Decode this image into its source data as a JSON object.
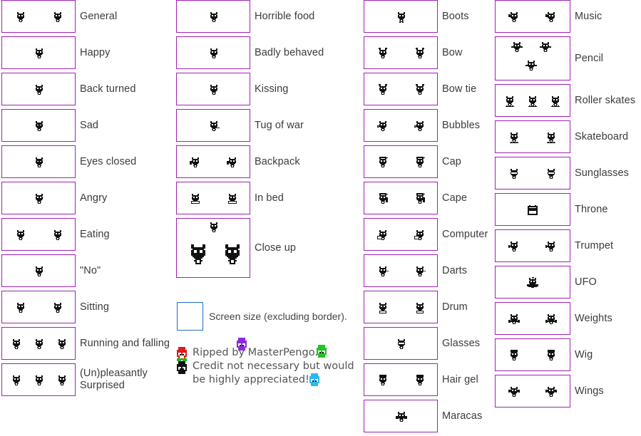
{
  "page": {
    "title": "Bub / pixel-art sprite sheet reference",
    "border_color": "#A021B5",
    "legend_border_color": "#1F6FC4",
    "text_color": "#3b3b3b",
    "background": "#ffffff"
  },
  "columns": [
    {
      "id": "column-1",
      "rows": [
        {
          "label": "General",
          "sprite_count": 2,
          "sprite": "creature-standing"
        },
        {
          "label": "Happy",
          "sprite_count": 1,
          "sprite": "creature-happy"
        },
        {
          "label": "Back turned",
          "sprite_count": 1,
          "sprite": "creature-back"
        },
        {
          "label": "Sad",
          "sprite_count": 1,
          "sprite": "creature-sad"
        },
        {
          "label": "Eyes closed",
          "sprite_count": 1,
          "sprite": "creature-eyes-closed"
        },
        {
          "label": "Angry",
          "sprite_count": 1,
          "sprite": "creature-angry"
        },
        {
          "label": "Eating",
          "sprite_count": 2,
          "sprite": "creature-eating"
        },
        {
          "label": "\"No\"",
          "sprite_count": 1,
          "sprite": "creature-no"
        },
        {
          "label": "Sitting",
          "sprite_count": 2,
          "sprite": "creature-sitting"
        },
        {
          "label": "Running and falling",
          "sprite_count": 3,
          "sprite": "creature-running"
        },
        {
          "label": "(Un)pleasantly\nSurprised",
          "sprite_count": 3,
          "sprite": "creature-surprised"
        }
      ]
    },
    {
      "id": "column-2",
      "rows": [
        {
          "label": "Horrible food",
          "sprite_count": 1,
          "sprite": "creature-horrible-food"
        },
        {
          "label": "Badly behaved",
          "sprite_count": 1,
          "sprite": "creature-badly-behaved"
        },
        {
          "label": "Kissing",
          "sprite_count": 1,
          "sprite": "creature-kissing"
        },
        {
          "label": "Tug of war",
          "sprite_count": 1,
          "sprite": "creature-tug-of-war"
        },
        {
          "label": "Backpack",
          "sprite_count": 2,
          "sprite": "creature-backpack"
        },
        {
          "label": "In bed",
          "sprite_count": 2,
          "sprite": "creature-in-bed"
        },
        {
          "label": "Close up",
          "sprite_count": 3,
          "sprite": "creature-close-up",
          "tall": true
        }
      ]
    },
    {
      "id": "column-3",
      "rows": [
        {
          "label": "Boots",
          "sprite_count": 1,
          "sprite": "creature-boots"
        },
        {
          "label": "Bow",
          "sprite_count": 2,
          "sprite": "creature-bow"
        },
        {
          "label": "Bow tie",
          "sprite_count": 2,
          "sprite": "creature-bow-tie"
        },
        {
          "label": "Bubbles",
          "sprite_count": 2,
          "sprite": "creature-bubbles"
        },
        {
          "label": "Cap",
          "sprite_count": 2,
          "sprite": "creature-cap"
        },
        {
          "label": "Cape",
          "sprite_count": 2,
          "sprite": "creature-cape"
        },
        {
          "label": "Computer",
          "sprite_count": 2,
          "sprite": "creature-computer"
        },
        {
          "label": "Darts",
          "sprite_count": 2,
          "sprite": "creature-darts"
        },
        {
          "label": "Drum",
          "sprite_count": 2,
          "sprite": "creature-drum"
        },
        {
          "label": "Glasses",
          "sprite_count": 1,
          "sprite": "creature-glasses"
        },
        {
          "label": "Hair gel",
          "sprite_count": 2,
          "sprite": "creature-hair-gel"
        },
        {
          "label": "Maracas",
          "sprite_count": 1,
          "sprite": "creature-maracas"
        }
      ]
    },
    {
      "id": "column-4",
      "rows": [
        {
          "label": "Music",
          "sprite_count": 2,
          "sprite": "creature-music"
        },
        {
          "label": "Pencil",
          "sprite_count": 3,
          "sprite": "creature-pencil",
          "tall": true
        },
        {
          "label": "Roller skates",
          "sprite_count": 3,
          "sprite": "creature-roller-skates"
        },
        {
          "label": "Skateboard",
          "sprite_count": 2,
          "sprite": "creature-skateboard"
        },
        {
          "label": "Sunglasses",
          "sprite_count": 2,
          "sprite": "creature-sunglasses"
        },
        {
          "label": "Throne",
          "sprite_count": 1,
          "sprite": "creature-throne"
        },
        {
          "label": "Trumpet",
          "sprite_count": 2,
          "sprite": "creature-trumpet"
        },
        {
          "label": "UFO",
          "sprite_count": 1,
          "sprite": "creature-ufo"
        },
        {
          "label": "Weights",
          "sprite_count": 2,
          "sprite": "creature-weights"
        },
        {
          "label": "Wig",
          "sprite_count": 2,
          "sprite": "creature-wig"
        },
        {
          "label": "Wings",
          "sprite_count": 2,
          "sprite": "creature-wings"
        }
      ]
    }
  ],
  "legend": {
    "text": "Screen size (excluding border).",
    "box_border_color": "#1F6FC4"
  },
  "credit": {
    "line1": "Ripped by MasterPengo.",
    "line2": "Credit not necessary but would",
    "line3": "be highly appreciated!",
    "icons": {
      "bird": "bird-sprite-icon",
      "purple": "purple-creature-icon",
      "green": "green-creature-icon",
      "black": "black-creature-icon",
      "blue": "blue-creature-icon"
    },
    "icon_colors": {
      "bird_body": "#e01b1b",
      "bird_belly": "#ffffff",
      "bird_feet": "#1db81d",
      "purple": "#8a2be2",
      "green": "#22c322",
      "blue": "#2bb7f0",
      "black": "#111111"
    }
  }
}
